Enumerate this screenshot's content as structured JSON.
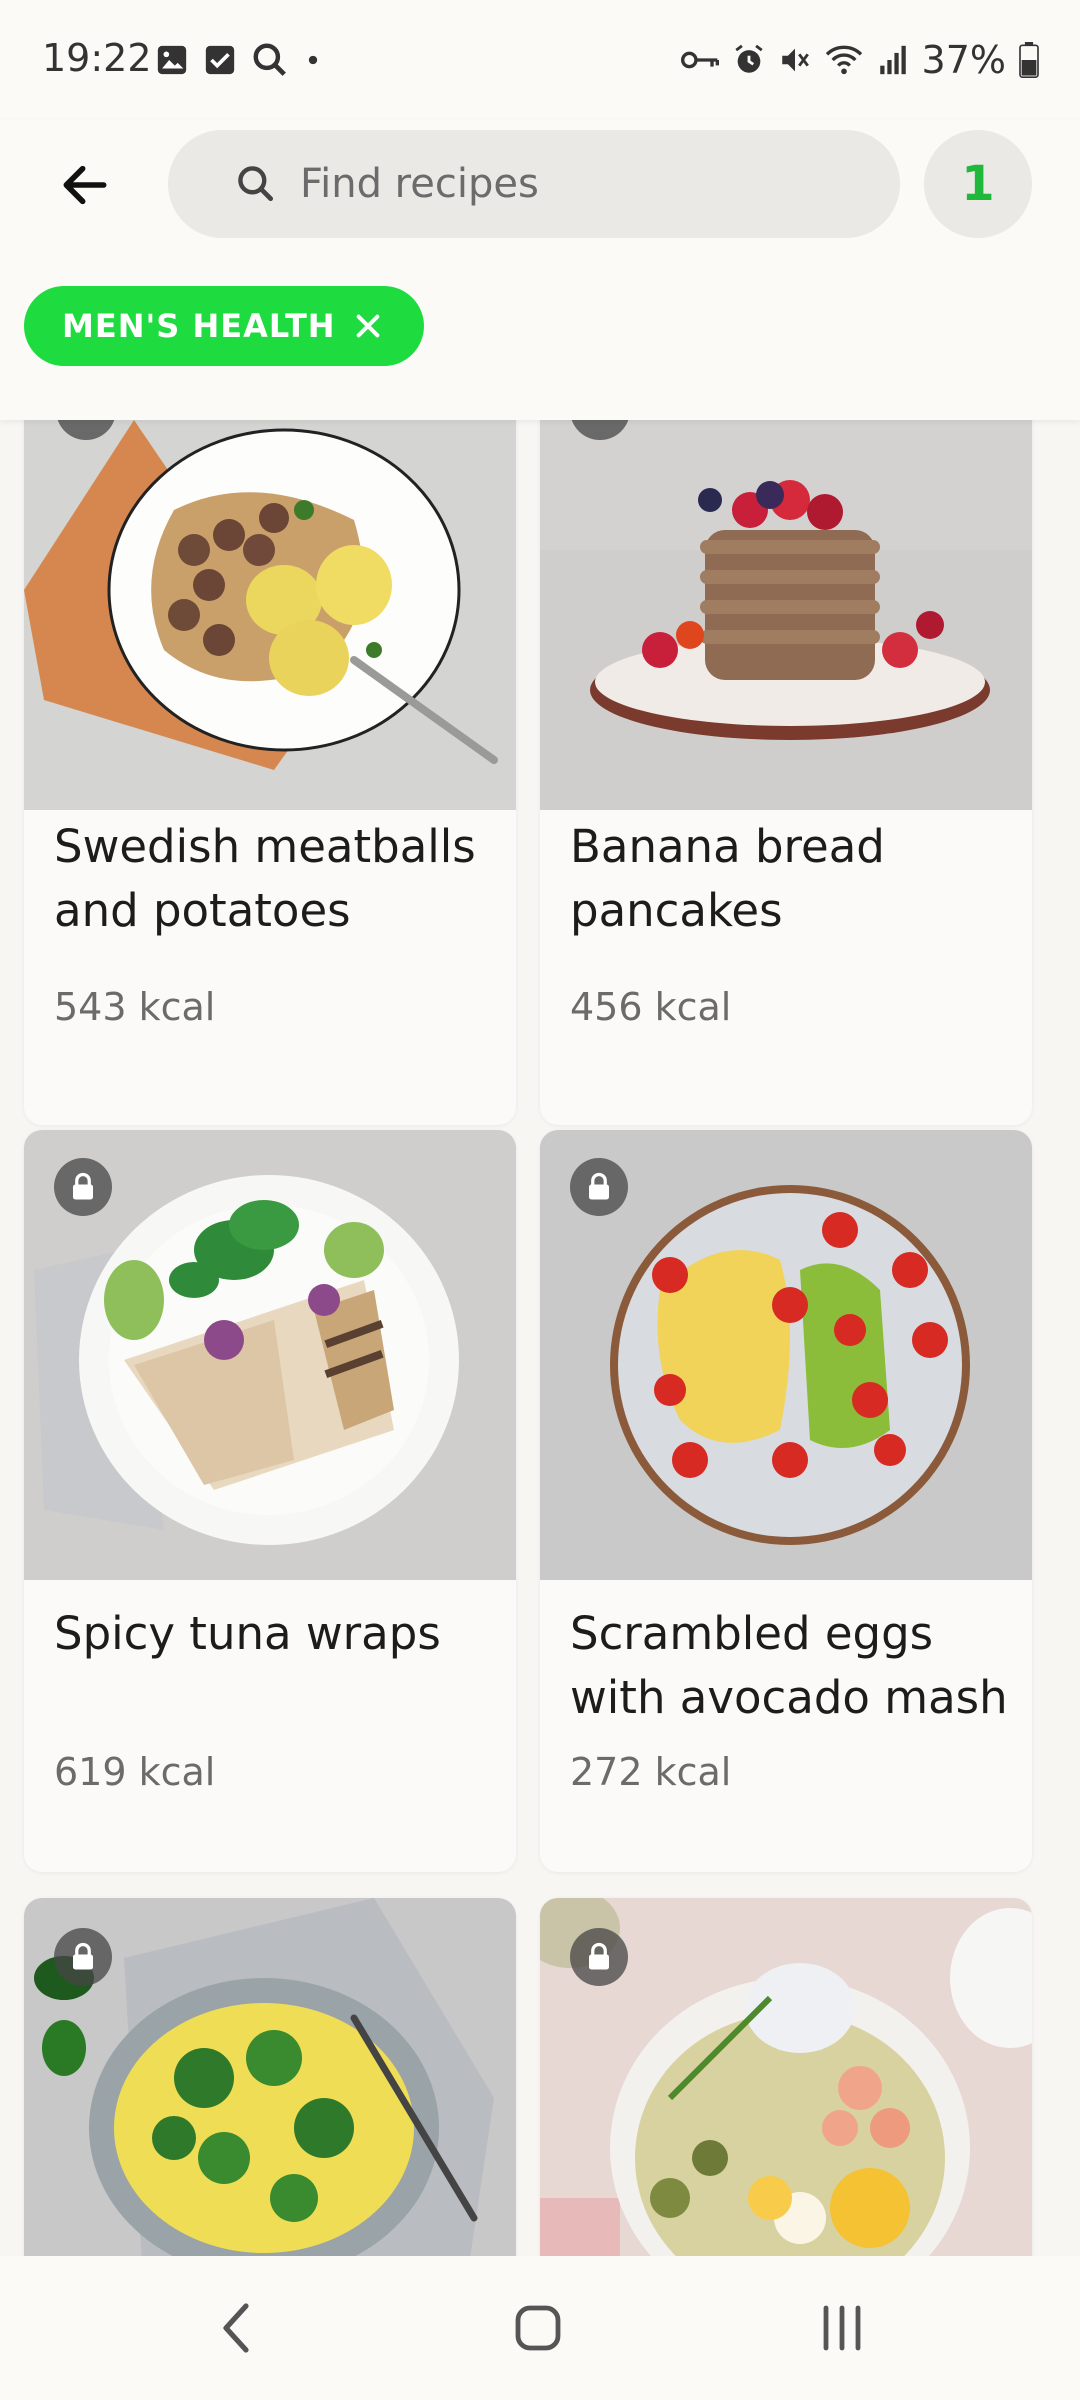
{
  "status_bar": {
    "time": "19:22",
    "battery": "37%",
    "left_icons": [
      "gallery-icon",
      "check-box-icon",
      "search-icon",
      "dot-icon"
    ],
    "right_icons": [
      "vpn-key-icon",
      "alarm-icon",
      "mute-icon",
      "wifi-icon",
      "signal-icon",
      "battery-icon"
    ]
  },
  "header": {
    "search_placeholder": "Find recipes",
    "filter_count": "1"
  },
  "filters": [
    {
      "label": "MEN'S HEALTH"
    }
  ],
  "recipes": [
    {
      "title": "Swedish meatballs and potatoes",
      "kcal": "543 kcal",
      "locked": true
    },
    {
      "title": "Banana bread pancakes",
      "kcal": "456 kcal",
      "locked": true
    },
    {
      "title": "Spicy tuna wraps",
      "kcal": "619 kcal",
      "locked": true
    },
    {
      "title": "Scrambled eggs with avocado mash",
      "kcal": "272 kcal",
      "locked": true
    },
    {
      "title": "",
      "kcal": "",
      "locked": true
    },
    {
      "title": "",
      "kcal": "",
      "locked": true
    }
  ],
  "colors": {
    "accent": "#1edb3f",
    "badge_text": "#1fb83a",
    "background": "#f7f6f3"
  }
}
